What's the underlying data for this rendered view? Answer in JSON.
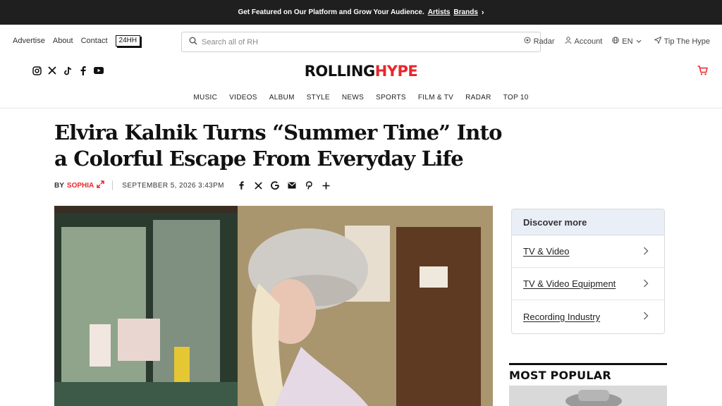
{
  "promo": {
    "text": "Get Featured on Our Platform and Grow Your Audience.",
    "link1": "Artists",
    "link2": "Brands",
    "chevron": "›"
  },
  "util": {
    "links": [
      "Advertise",
      "About",
      "Contact"
    ],
    "badge": "24HH",
    "search_placeholder": "Search all of RH",
    "right": {
      "radar": "Radar",
      "account": "Account",
      "lang": "EN",
      "tip": "Tip The Hype"
    }
  },
  "brand": {
    "logo_a": "ROLLING",
    "logo_b": "HYPE"
  },
  "socials": [
    "instagram-icon",
    "x-icon",
    "tiktok-icon",
    "facebook-icon",
    "youtube-icon"
  ],
  "nav": [
    "MUSIC",
    "VIDEOS",
    "ALBUM",
    "STYLE",
    "NEWS",
    "SPORTS",
    "FILM & TV",
    "RADAR",
    "TOP 10"
  ],
  "article": {
    "headline": "Elvira Kalnik Turns “Summer Time” Into a Colorful Escape From Everyday Life",
    "by": "BY",
    "author": "SOPHIA",
    "date": "SEPTEMBER 5, 2026 3:43PM",
    "share_icons": [
      "facebook-icon",
      "x-icon",
      "google-icon",
      "email-icon",
      "pinterest-icon",
      "plus-icon"
    ]
  },
  "sidebar": {
    "discover_title": "Discover more",
    "discover_items": [
      "TV & Video",
      "TV & Video Equipment",
      "Recording Industry"
    ],
    "most_popular": "MOST POPULAR"
  },
  "colors": {
    "accent": "#e8262c",
    "promo_bg": "#1f1f1f",
    "discover_hdr": "#e9eef7"
  }
}
